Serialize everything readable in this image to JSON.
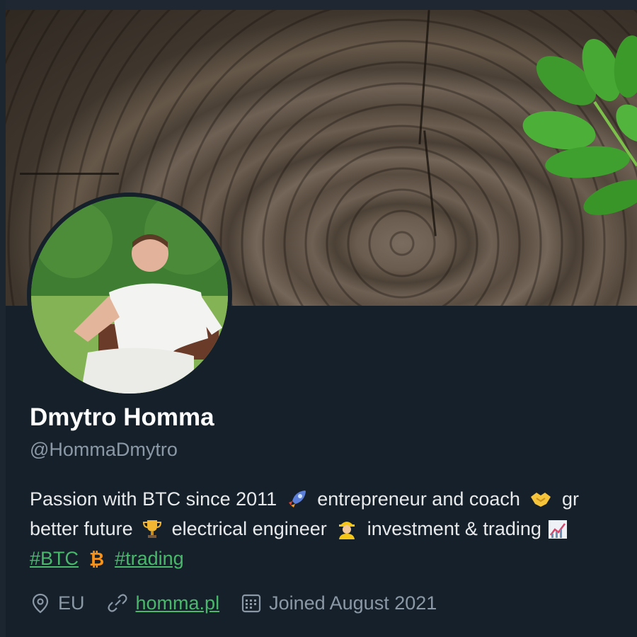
{
  "profile": {
    "name": "Dmytro Homma",
    "handle": "@HommaDmytro",
    "bio": {
      "line1_a": "Passion with BTC since 2011",
      "line1_b": "entrepreneur and coach",
      "line1_c": "gr",
      "line2_a": "better future",
      "line2_b": "electrical engineer",
      "line2_c": "investment & trading",
      "hashtags": [
        "#BTC",
        "#trading"
      ]
    },
    "meta": {
      "location": "EU",
      "website": "homma.pl",
      "joined": "Joined August 2021"
    }
  },
  "colors": {
    "background": "#15202b",
    "name": "#ffffff",
    "secondary_text": "#8b98a5",
    "link": "#49b86b"
  },
  "icons": {
    "location": "location-pin-icon",
    "website": "link-icon",
    "joined": "calendar-icon",
    "bio_emojis": [
      "rocket-icon",
      "handshake-icon",
      "trophy-icon",
      "construction-worker-icon",
      "chart-icon",
      "bitcoin-icon"
    ]
  }
}
